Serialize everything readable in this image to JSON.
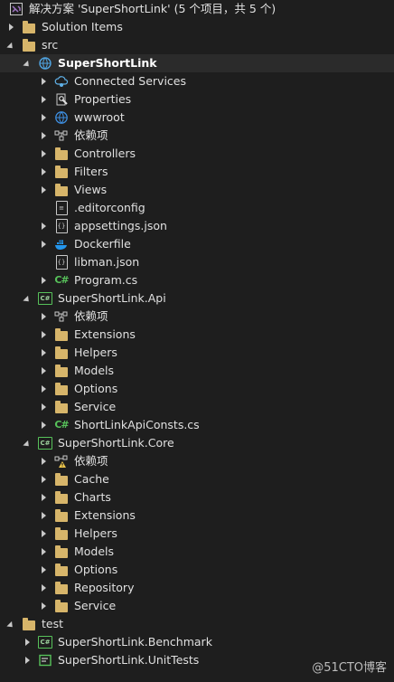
{
  "solution": {
    "title": "解决方案 'SuperShortLink' (5 个项目，共 5 个)"
  },
  "items": [
    {
      "label": "Solution Items",
      "indent": 0,
      "arrow": "right",
      "icon": "folder"
    },
    {
      "label": "src",
      "indent": 0,
      "arrow": "down",
      "icon": "folder"
    },
    {
      "label": "SuperShortLink",
      "indent": 1,
      "arrow": "down",
      "icon": "web-project",
      "selected": true
    },
    {
      "label": "Connected Services",
      "indent": 2,
      "arrow": "right",
      "icon": "connected-services"
    },
    {
      "label": "Properties",
      "indent": 2,
      "arrow": "right",
      "icon": "properties"
    },
    {
      "label": "wwwroot",
      "indent": 2,
      "arrow": "right",
      "icon": "globe"
    },
    {
      "label": "依赖项",
      "indent": 2,
      "arrow": "right",
      "icon": "dependencies"
    },
    {
      "label": "Controllers",
      "indent": 2,
      "arrow": "right",
      "icon": "folder"
    },
    {
      "label": "Filters",
      "indent": 2,
      "arrow": "right",
      "icon": "folder"
    },
    {
      "label": "Views",
      "indent": 2,
      "arrow": "right",
      "icon": "folder"
    },
    {
      "label": ".editorconfig",
      "indent": 2,
      "arrow": "none",
      "icon": "config-file"
    },
    {
      "label": "appsettings.json",
      "indent": 2,
      "arrow": "right",
      "icon": "json-file"
    },
    {
      "label": "Dockerfile",
      "indent": 2,
      "arrow": "right",
      "icon": "docker"
    },
    {
      "label": "libman.json",
      "indent": 2,
      "arrow": "none",
      "icon": "json-file"
    },
    {
      "label": "Program.cs",
      "indent": 2,
      "arrow": "right",
      "icon": "csharp"
    },
    {
      "label": "SuperShortLink.Api",
      "indent": 1,
      "arrow": "down",
      "icon": "cs-project"
    },
    {
      "label": "依赖项",
      "indent": 2,
      "arrow": "right",
      "icon": "dependencies"
    },
    {
      "label": "Extensions",
      "indent": 2,
      "arrow": "right",
      "icon": "folder"
    },
    {
      "label": "Helpers",
      "indent": 2,
      "arrow": "right",
      "icon": "folder"
    },
    {
      "label": "Models",
      "indent": 2,
      "arrow": "right",
      "icon": "folder"
    },
    {
      "label": "Options",
      "indent": 2,
      "arrow": "right",
      "icon": "folder"
    },
    {
      "label": "Service",
      "indent": 2,
      "arrow": "right",
      "icon": "folder"
    },
    {
      "label": "ShortLinkApiConsts.cs",
      "indent": 2,
      "arrow": "right",
      "icon": "csharp"
    },
    {
      "label": "SuperShortLink.Core",
      "indent": 1,
      "arrow": "down",
      "icon": "cs-project"
    },
    {
      "label": "依赖项",
      "indent": 2,
      "arrow": "right",
      "icon": "dependencies-warning"
    },
    {
      "label": "Cache",
      "indent": 2,
      "arrow": "right",
      "icon": "folder"
    },
    {
      "label": "Charts",
      "indent": 2,
      "arrow": "right",
      "icon": "folder"
    },
    {
      "label": "Extensions",
      "indent": 2,
      "arrow": "right",
      "icon": "folder"
    },
    {
      "label": "Helpers",
      "indent": 2,
      "arrow": "right",
      "icon": "folder"
    },
    {
      "label": "Models",
      "indent": 2,
      "arrow": "right",
      "icon": "folder"
    },
    {
      "label": "Options",
      "indent": 2,
      "arrow": "right",
      "icon": "folder"
    },
    {
      "label": "Repository",
      "indent": 2,
      "arrow": "right",
      "icon": "folder"
    },
    {
      "label": "Service",
      "indent": 2,
      "arrow": "right",
      "icon": "folder"
    },
    {
      "label": "test",
      "indent": 0,
      "arrow": "down",
      "icon": "folder"
    },
    {
      "label": "SuperShortLink.Benchmark",
      "indent": 1,
      "arrow": "right",
      "icon": "cs-project"
    },
    {
      "label": "SuperShortLink.UnitTests",
      "indent": 1,
      "arrow": "right",
      "icon": "test-project"
    }
  ],
  "watermark": "@51CTO博客",
  "colors": {
    "background": "#1e1e1e",
    "folder": "#d7b56a",
    "csharp": "#57c25a",
    "selected": "#2b2b2b"
  }
}
